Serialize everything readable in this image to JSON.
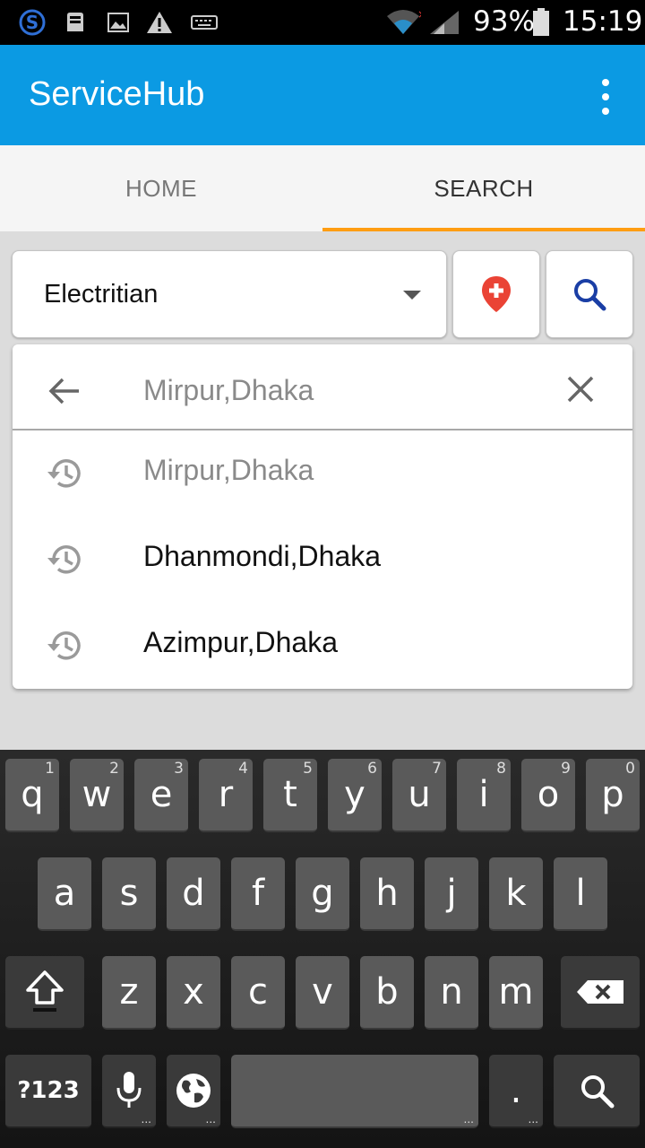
{
  "status_bar": {
    "battery_percent": "93%",
    "time": "15:19",
    "icons": [
      "skype-icon",
      "sd-card-icon",
      "image-icon",
      "warning-icon",
      "keyboard-icon",
      "wifi-icon",
      "signal-icon",
      "battery-icon"
    ]
  },
  "app_bar": {
    "title": "ServiceHub",
    "menu_icon": "overflow-menu-icon"
  },
  "tabs": [
    {
      "label": "HOME",
      "selected": false
    },
    {
      "label": "SEARCH",
      "selected": true
    }
  ],
  "colors": {
    "primary": "#0b9ae3",
    "tab_indicator": "#ff9d12",
    "location_pin": "#ea4335",
    "search_icon": "#1a3ea5"
  },
  "service_spinner": {
    "selected": "Electritian"
  },
  "location_search": {
    "query_placeholder": "Mirpur,Dhaka",
    "query_value": "",
    "suggestions": [
      {
        "label": "Mirpur,Dhaka",
        "icon": "history-icon"
      },
      {
        "label": "Dhanmondi,Dhaka",
        "icon": "history-icon"
      },
      {
        "label": "Azimpur,Dhaka",
        "icon": "history-icon"
      }
    ]
  },
  "keyboard": {
    "row1": [
      {
        "k": "q",
        "h": "1"
      },
      {
        "k": "w",
        "h": "2"
      },
      {
        "k": "e",
        "h": "3"
      },
      {
        "k": "r",
        "h": "4"
      },
      {
        "k": "t",
        "h": "5"
      },
      {
        "k": "y",
        "h": "6"
      },
      {
        "k": "u",
        "h": "7"
      },
      {
        "k": "i",
        "h": "8"
      },
      {
        "k": "o",
        "h": "9"
      },
      {
        "k": "p",
        "h": "0"
      }
    ],
    "row2": [
      "a",
      "s",
      "d",
      "f",
      "g",
      "h",
      "j",
      "k",
      "l"
    ],
    "row3": [
      "z",
      "x",
      "c",
      "v",
      "b",
      "n",
      "m"
    ],
    "symbols_label": "?123",
    "period_label": "."
  }
}
